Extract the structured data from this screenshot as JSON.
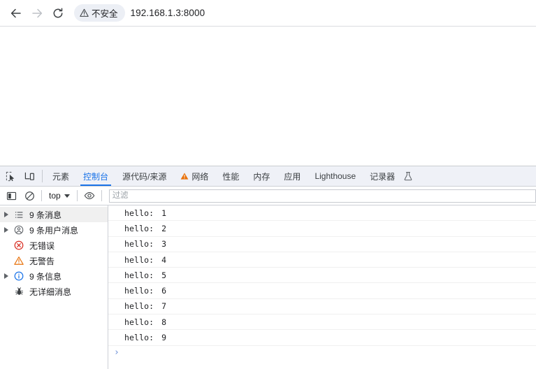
{
  "browser": {
    "back_label": "Back",
    "forward_label": "Forward",
    "reload_label": "Reload",
    "security_chip": {
      "icon": "warning-triangle-icon",
      "label": "不安全"
    },
    "url": "192.168.1.3:8000"
  },
  "devtools": {
    "left_buttons": [
      {
        "name": "inspect-element-icon",
        "label": "Inspect"
      },
      {
        "name": "device-toolbar-icon",
        "label": "Toggle device toolbar"
      }
    ],
    "tabs": [
      {
        "label": "元素",
        "active": false,
        "warning": false
      },
      {
        "label": "控制台",
        "active": true,
        "warning": false
      },
      {
        "label": "源代码/来源",
        "active": false,
        "warning": false
      },
      {
        "label": "网络",
        "active": false,
        "warning": true
      },
      {
        "label": "性能",
        "active": false,
        "warning": false
      },
      {
        "label": "内存",
        "active": false,
        "warning": false
      },
      {
        "label": "应用",
        "active": false,
        "warning": false
      },
      {
        "label": "Lighthouse",
        "active": false,
        "warning": false
      },
      {
        "label": "记录器",
        "active": false,
        "warning": false
      }
    ],
    "flask_icon": "flask-icon",
    "console_toolbar": {
      "sidebar_toggle_icon": "console-sidebar-toggle-icon",
      "clear_console_icon": "clear-console-icon",
      "context_selector": "top",
      "eye_icon": "live-expression-eye-icon",
      "filter_placeholder": "过滤",
      "filter_value": ""
    },
    "sidebar": [
      {
        "label": "9 条消息",
        "icon": "list-icon",
        "expandable": true,
        "selected": true
      },
      {
        "label": "9 条用户消息",
        "icon": "user-circle-icon",
        "expandable": true,
        "selected": false
      },
      {
        "label": "无错误",
        "icon": "error-circle-icon",
        "expandable": false,
        "selected": false
      },
      {
        "label": "无警告",
        "icon": "warning-triangle-icon",
        "expandable": false,
        "selected": false
      },
      {
        "label": "9 条信息",
        "icon": "info-circle-icon",
        "expandable": true,
        "selected": false
      },
      {
        "label": "无详细消息",
        "icon": "bug-icon",
        "expandable": false,
        "selected": false
      }
    ],
    "messages": [
      {
        "label": "hello:",
        "value": "1"
      },
      {
        "label": "hello:",
        "value": "2"
      },
      {
        "label": "hello:",
        "value": "3"
      },
      {
        "label": "hello:",
        "value": "4"
      },
      {
        "label": "hello:",
        "value": "5"
      },
      {
        "label": "hello:",
        "value": "6"
      },
      {
        "label": "hello:",
        "value": "7"
      },
      {
        "label": "hello:",
        "value": "8"
      },
      {
        "label": "hello:",
        "value": "9"
      }
    ],
    "prompt": {
      "caret": "›",
      "value": ""
    }
  },
  "colors": {
    "accent": "#1a73e8",
    "warning": "#e8710a",
    "error": "#d93025",
    "info": "#1a73e8",
    "tabbar_bg": "#eff1f7"
  }
}
